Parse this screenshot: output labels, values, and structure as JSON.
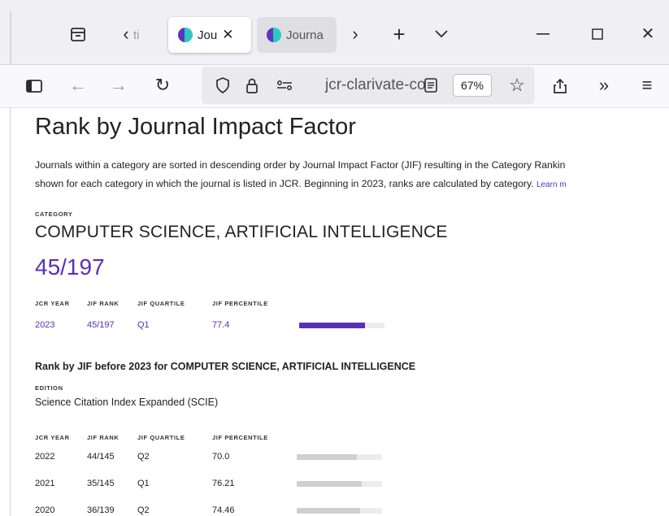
{
  "browser": {
    "tabs": [
      {
        "label": "ti",
        "state": "collapsed"
      },
      {
        "label": "Jou",
        "state": "active"
      },
      {
        "label": "Journa",
        "state": "inactive"
      }
    ],
    "url": "jcr-clarivate-co",
    "zoom": "67%"
  },
  "page": {
    "title": "Rank by Journal Impact Factor",
    "intro_line1": "Journals within a category are sorted in descending order by Journal Impact Factor (JIF) resulting in the Category Rankin",
    "intro_line2": "shown for each category in which the journal is listed in JCR. Beginning in 2023, ranks are calculated by category.",
    "learn_more": "Learn m",
    "category_label": "CATEGORY",
    "category_name": "COMPUTER SCIENCE, ARTIFICIAL INTELLIGENCE",
    "current_rank": "45/197",
    "columns": {
      "year": "JCR YEAR",
      "rank": "JIF RANK",
      "quartile": "JIF QUARTILE",
      "percentile": "JIF PERCENTILE"
    },
    "current_row": {
      "year": "2023",
      "rank": "45/197",
      "quartile": "Q1",
      "percentile": "77.4",
      "percentile_value": 77.4
    },
    "history_heading": "Rank by JIF before 2023 for COMPUTER SCIENCE, ARTIFICIAL INTELLIGENCE",
    "edition_label": "EDITION",
    "edition_value": "Science Citation Index Expanded (SCIE)",
    "history_rows": [
      {
        "year": "2022",
        "rank": "44/145",
        "quartile": "Q2",
        "percentile": "70.0",
        "percentile_value": 70.0
      },
      {
        "year": "2021",
        "rank": "35/145",
        "quartile": "Q1",
        "percentile": "76.21",
        "percentile_value": 76.21
      },
      {
        "year": "2020",
        "rank": "36/139",
        "quartile": "Q2",
        "percentile": "74.46",
        "percentile_value": 74.46
      }
    ]
  },
  "colors": {
    "accent": "#5b2fb5",
    "bar_track": "#ececec",
    "bar_grey": "#cfcfcf"
  }
}
